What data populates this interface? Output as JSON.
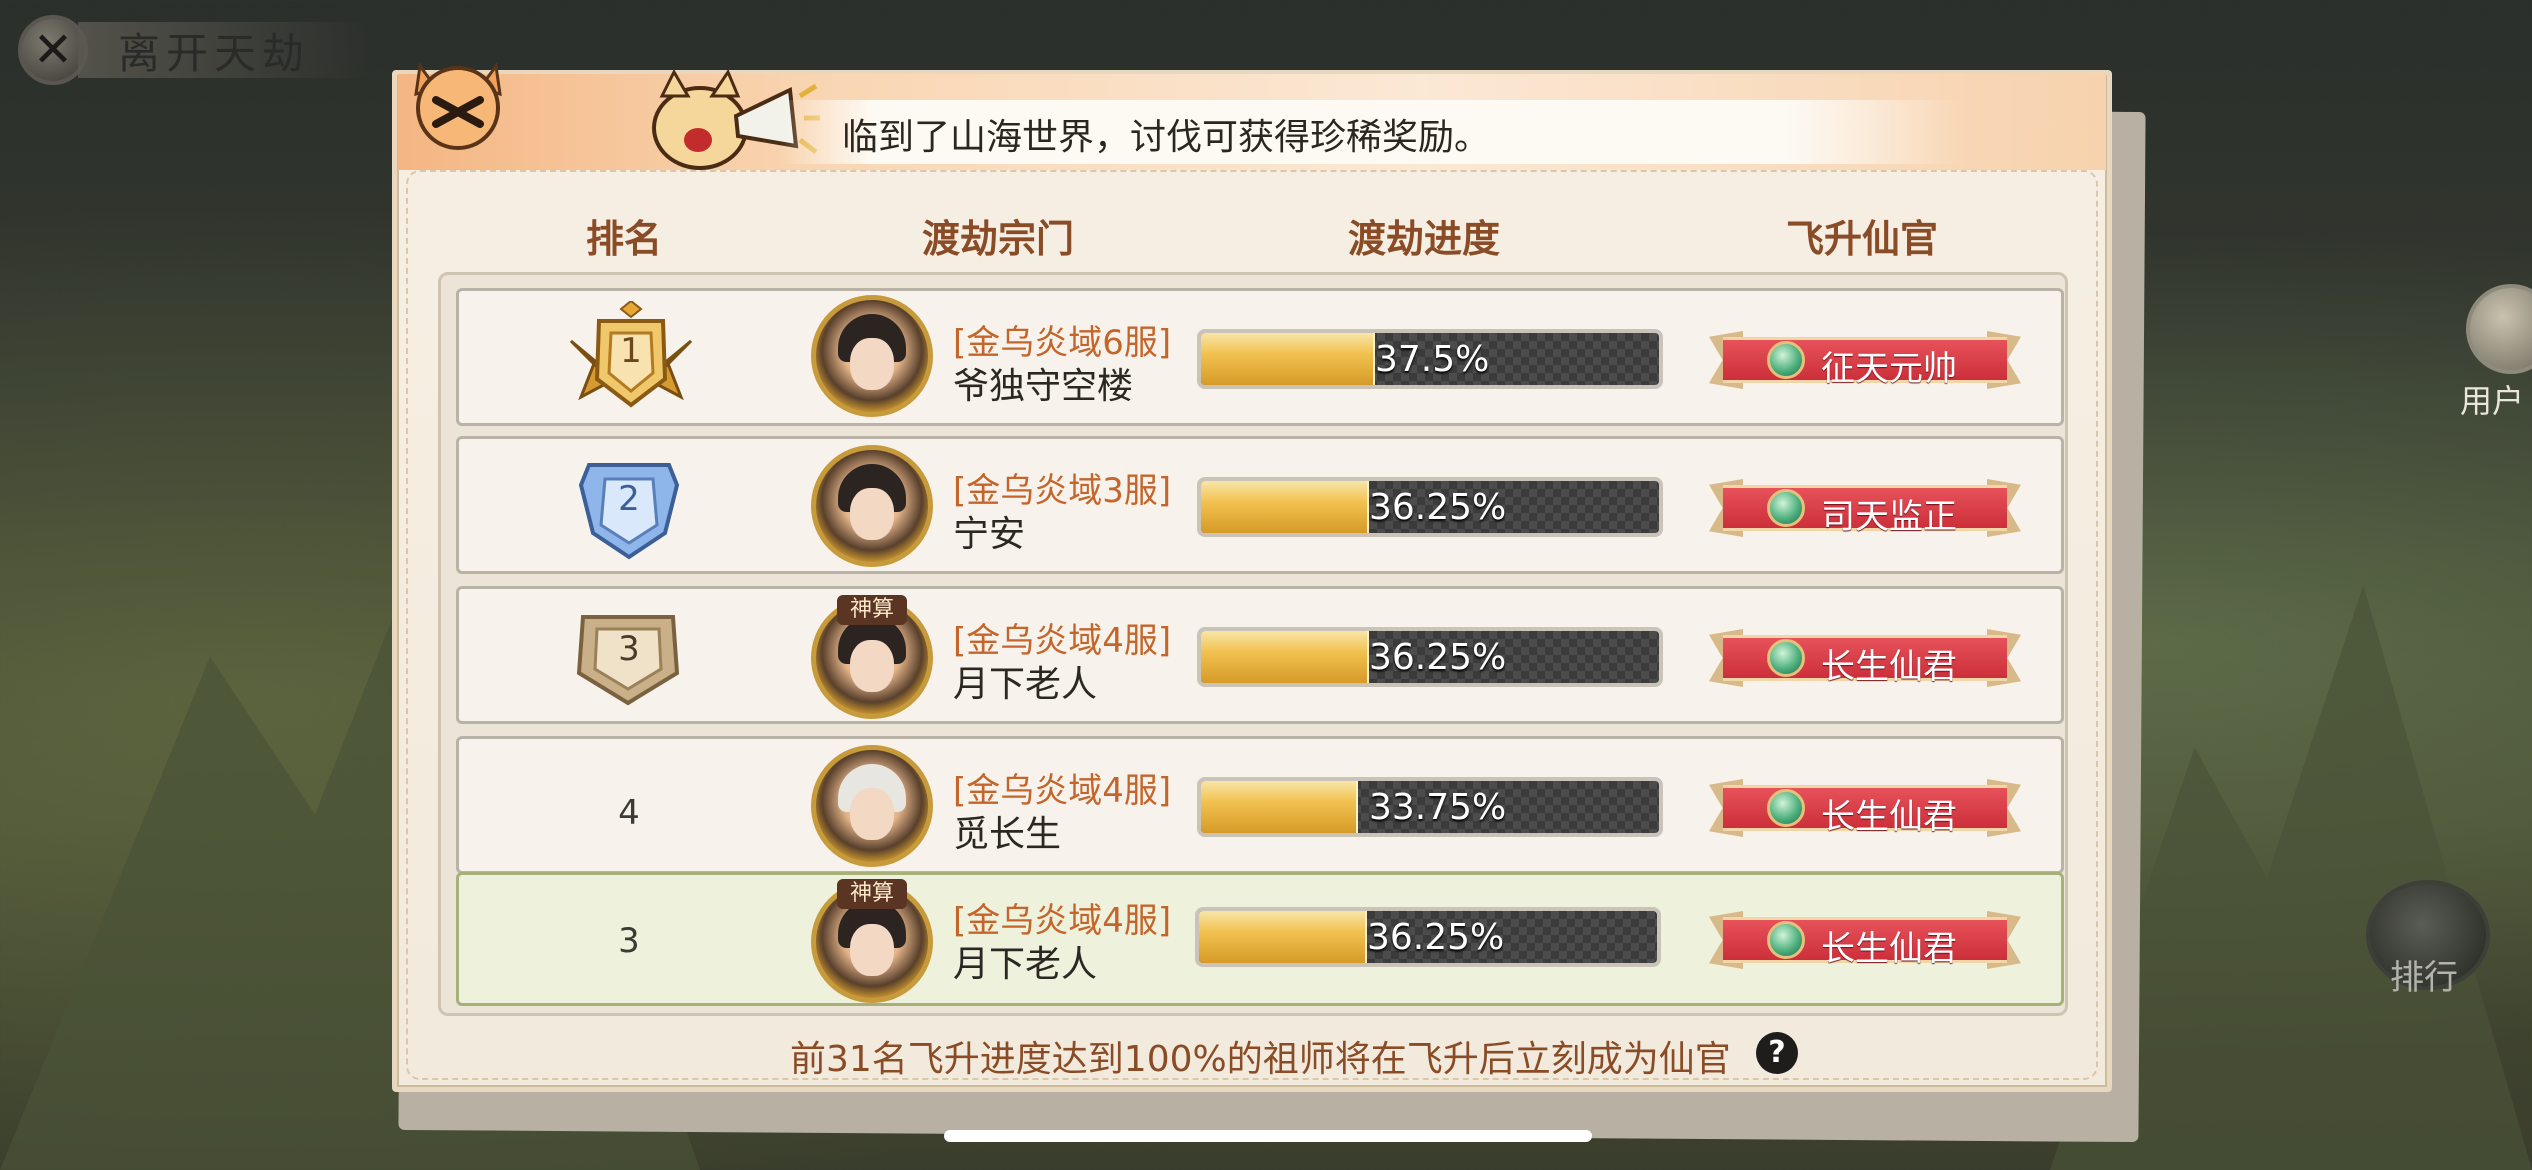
{
  "leave_button": {
    "label": "离开天劫"
  },
  "banner": {
    "text": "临到了山海世界，讨伐可获得珍稀奖励。"
  },
  "columns": {
    "rank": "排名",
    "sect": "渡劫宗门",
    "progress": "渡劫进度",
    "title": "飞升仙官"
  },
  "rows": [
    {
      "rank": "1",
      "server": "[金乌炎域6服]",
      "name": "爷独守空楼",
      "progress": "37.5%",
      "progress_value": 37.5,
      "title": "征天元帅",
      "avatar_tag": ""
    },
    {
      "rank": "2",
      "server": "[金乌炎域3服]",
      "name": "宁安",
      "progress": "36.25%",
      "progress_value": 36.25,
      "title": "司天监正",
      "avatar_tag": ""
    },
    {
      "rank": "3",
      "server": "[金乌炎域4服]",
      "name": "月下老人",
      "progress": "36.25%",
      "progress_value": 36.25,
      "title": "长生仙君",
      "avatar_tag": "神算"
    },
    {
      "rank": "4",
      "server": "[金乌炎域4服]",
      "name": "觅长生",
      "progress": "33.75%",
      "progress_value": 33.75,
      "title": "长生仙君",
      "avatar_tag": ""
    }
  ],
  "self_row": {
    "rank": "3",
    "server": "[金乌炎域4服]",
    "name": "月下老人",
    "progress": "36.25%",
    "progress_value": 36.25,
    "title": "长生仙君",
    "avatar_tag": "神算"
  },
  "footer": {
    "note": "前31名飞升进度达到100%的祖师将在飞升后立刻成为仙官",
    "help_icon": "?"
  },
  "side": {
    "user_label": "用户",
    "rank_label": "排行"
  },
  "colors": {
    "accent_brown": "#8a4c26",
    "server_orange": "#c4662b",
    "title_red": "#cc2f3a",
    "bar_gold": "#f2c250"
  }
}
